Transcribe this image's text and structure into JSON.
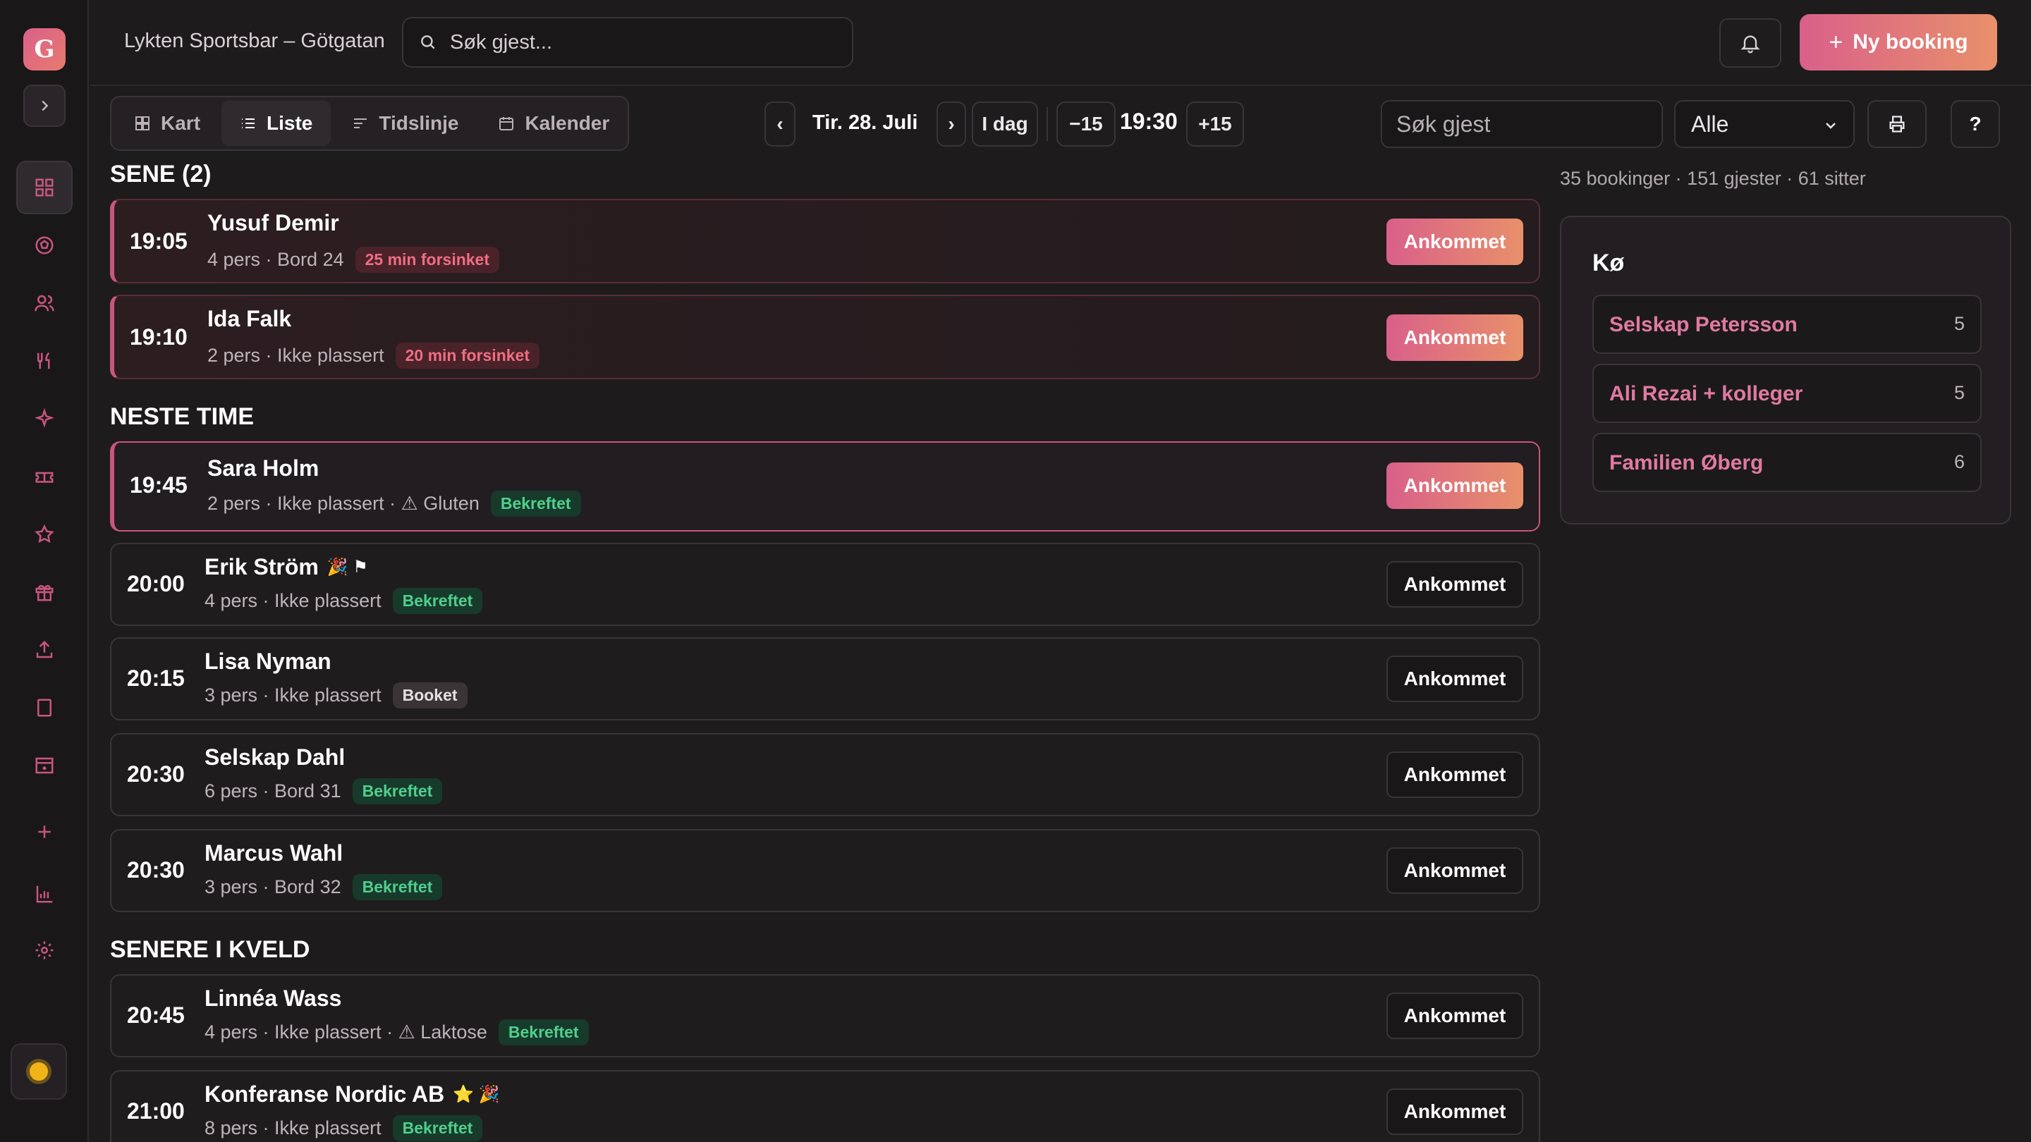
{
  "app": {
    "logo_letter": "G",
    "venue": "Lykten Sportsbar – Götgatan"
  },
  "topbar": {
    "search_placeholder": "Søk gjest...",
    "new_booking_label": "Ny booking"
  },
  "view_tabs": [
    {
      "label": "Kart",
      "icon": "grid-icon",
      "active": false
    },
    {
      "label": "Liste",
      "icon": "list-icon",
      "active": true
    },
    {
      "label": "Tidslinje",
      "icon": "timeline-icon",
      "active": false
    },
    {
      "label": "Kalender",
      "icon": "calendar-icon",
      "active": false
    }
  ],
  "date_controls": {
    "prev": "‹",
    "next": "›",
    "date": "Tir. 28. Juli",
    "today": "I dag",
    "minus": "−15",
    "time": "19:30",
    "plus": "+15"
  },
  "filters": {
    "guest_search_placeholder": "Søk gjest",
    "select_value": "Alle",
    "help": "?"
  },
  "stats": "35 bookinger · 151 gjester · 61 sitter",
  "sections": {
    "late": "SENE (2)",
    "next": "NESTE TIME",
    "later": "SENERE I KVELD"
  },
  "bookings": [
    {
      "time": "19:05",
      "name": "Yusuf Demir",
      "meta": "4 pers · Bord 24",
      "badge": "25 min forsinket",
      "action": "Ankommet"
    },
    {
      "time": "19:10",
      "name": "Ida Falk",
      "meta": "2 pers · Ikke plassert",
      "badge": "20 min forsinket",
      "action": "Ankommet"
    },
    {
      "time": "19:45",
      "name": "Sara Holm",
      "meta": "2 pers · Ikke plassert · ⚠ Gluten",
      "badge": "Bekreftet",
      "action": "Ankommet"
    },
    {
      "time": "20:00",
      "name": "Erik Ström",
      "meta": "4 pers · Ikke plassert",
      "badge": "Bekreftet",
      "action": "Ankommet",
      "emoji": "🎉 ⚑"
    },
    {
      "time": "20:15",
      "name": "Lisa Nyman",
      "meta": "3 pers · Ikke plassert",
      "badge": "Booket",
      "action": "Ankommet"
    },
    {
      "time": "20:30",
      "name": "Selskap Dahl",
      "meta": "6 pers · Bord 31",
      "badge": "Bekreftet",
      "action": "Ankommet"
    },
    {
      "time": "20:30",
      "name": "Marcus Wahl",
      "meta": "3 pers · Bord 32",
      "badge": "Bekreftet",
      "action": "Ankommet"
    },
    {
      "time": "20:45",
      "name": "Linnéa Wass",
      "meta": "4 pers · Ikke plassert · ⚠ Laktose",
      "badge": "Bekreftet",
      "action": "Ankommet"
    },
    {
      "time": "21:00",
      "name": "Konferanse Nordic AB",
      "meta": "8 pers · Ikke plassert",
      "badge": "Bekreftet",
      "action": "Ankommet",
      "emoji": "⭐ 🎉"
    }
  ],
  "queue": {
    "title": "Kø",
    "items": [
      {
        "name": "Selskap Petersson",
        "count": "5"
      },
      {
        "name": "Ali Rezai + kolleger",
        "count": "5"
      },
      {
        "name": "Familien Øberg",
        "count": "6"
      }
    ]
  },
  "colors": {
    "accent": "#c8567f",
    "gradient_start": "#d9608a",
    "gradient_end": "#e8906a",
    "confirmed": "#4fcf8d",
    "late": "#ef6e83"
  }
}
